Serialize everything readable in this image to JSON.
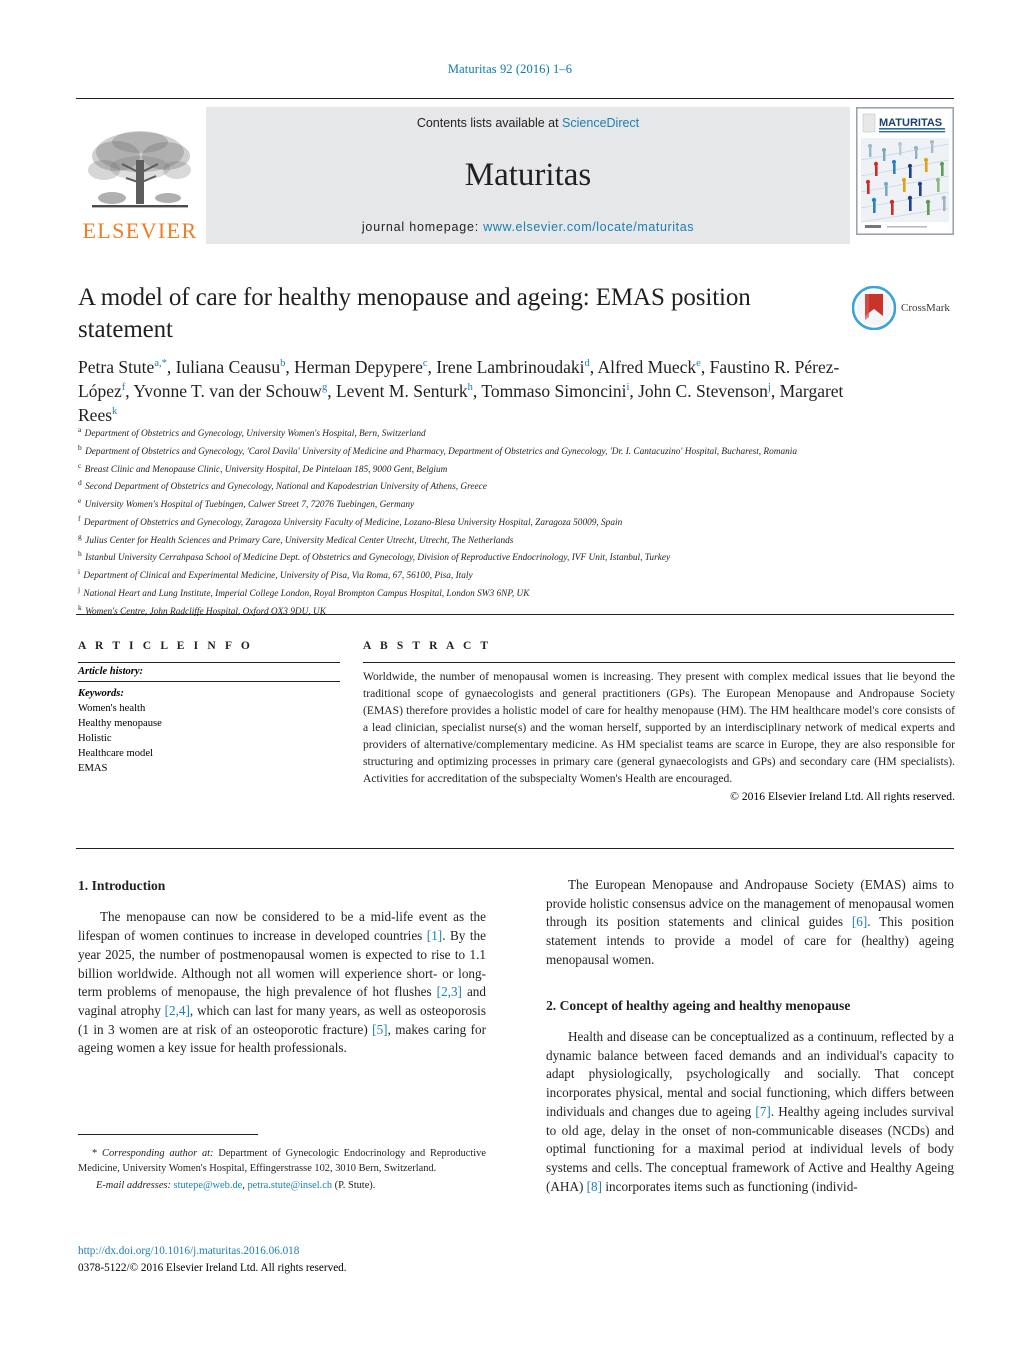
{
  "running_head": "Maturitas 92 (2016) 1–6",
  "masthead": {
    "publisher_name": "ELSEVIER",
    "contents_prefix": "Contents lists available at ",
    "contents_link": "ScienceDirect",
    "journal_name": "Maturitas",
    "homepage_label": "journal homepage:",
    "homepage_url": "www.elsevier.com/locate/maturitas",
    "cover_title": "MATURITAS",
    "link_color": "#1a7fb5",
    "band_color": "#e6e7e8",
    "elsevier_orange": "#ef7d23"
  },
  "article": {
    "title": "A model of care for healthy menopause and ageing: EMAS position statement",
    "crossmark_label": "CrossMark",
    "authors_html": "Petra Stute<sup>a</sup><sup>,*</sup>, Iuliana Ceausu<sup>b</sup>, Herman Depypere<sup>c</sup>, Irene Lambrinoudaki<sup>d</sup>, Alfred Mueck<sup>e</sup>, Faustino R. Pérez-López<sup>f</sup>, Yvonne T. van der Schouw<sup>g</sup>, Levent M. Senturk<sup>h</sup>, Tommaso Simoncini<sup>i</sup>, John C. Stevenson<sup>j</sup>, Margaret Rees<sup>k</sup>",
    "affiliations": [
      {
        "marker": "a",
        "text": "Department of Obstetrics and Gynecology, University Women's Hospital, Bern, Switzerland"
      },
      {
        "marker": "b",
        "text": "Department of Obstetrics and Gynecology, 'Carol Davila' University of Medicine and Pharmacy, Department of Obstetrics and Gynecology, 'Dr. I. Cantacuzino' Hospital, Bucharest, Romania"
      },
      {
        "marker": "c",
        "text": "Breast Clinic and Menopause Clinic, University Hospital, De Pintelaan 185, 9000 Gent, Belgium"
      },
      {
        "marker": "d",
        "text": "Second Department of Obstetrics and Gynecology, National and Kapodestrian University of Athens, Greece"
      },
      {
        "marker": "e",
        "text": "University Women's Hospital of Tuebingen, Calwer Street 7, 72076 Tuebingen, Germany"
      },
      {
        "marker": "f",
        "text": "Department of Obstetrics and Gynecology, Zaragoza University Faculty of Medicine, Lozano-Blesa University Hospital, Zaragoza 50009, Spain"
      },
      {
        "marker": "g",
        "text": "Julius Center for Health Sciences and Primary Care, University Medical Center Utrecht, Utrecht, The Netherlands"
      },
      {
        "marker": "h",
        "text": "Istanbul University Cerrahpasa School of Medicine Dept. of Obstetrics and Gynecology, Division of Reproductive Endocrinology, IVF Unit, Istanbul, Turkey"
      },
      {
        "marker": "i",
        "text": "Department of Clinical and Experimental Medicine, University of Pisa, Via Roma, 67, 56100, Pisa, Italy"
      },
      {
        "marker": "j",
        "text": "National Heart and Lung Institute, Imperial College London, Royal Brompton Campus Hospital, London SW3 6NP, UK"
      },
      {
        "marker": "k",
        "text": "Women's Centre, John Radcliffe Hospital, Oxford OX3 9DU, UK"
      }
    ]
  },
  "article_info": {
    "heading": "A R T I C L E   I N F O",
    "history_label": "Article history:",
    "keywords_label": "Keywords:",
    "keywords": [
      "Women's health",
      "Healthy menopause",
      "Holistic",
      "Healthcare model",
      "EMAS"
    ]
  },
  "abstract": {
    "heading": "A B S T R A C T",
    "text": "Worldwide, the number of menopausal women is increasing. They present with complex medical issues that lie beyond the traditional scope of gynaecologists and general practitioners (GPs). The European Menopause and Andropause Society (EMAS) therefore provides a holistic model of care for healthy menopause (HM). The HM healthcare model's core consists of a lead clinician, specialist nurse(s) and the woman herself, supported by an interdisciplinary network of medical experts and providers of alternative/complementary medicine. As HM specialist teams are scarce in Europe, they are also responsible for structuring and optimizing processes in primary care (general gynaecologists and GPs) and secondary care (HM specialists). Activities for accreditation of the subspecialty Women's Health are encouraged.",
    "copyright": "© 2016 Elsevier Ireland Ltd. All rights reserved."
  },
  "body": {
    "left": {
      "section1_heading": "1.  Introduction",
      "para1_html": "The menopause can now be considered to be a mid-life event as the lifespan of women continues to increase in developed countries <span class=\"ref\">[1]</span>. By the year 2025, the number of postmenopausal women is expected to rise to 1.1 billion worldwide. Although not all women will experience short- or long-term problems of menopause, the high prevalence of hot flushes <span class=\"ref\">[2,3]</span> and vaginal atrophy <span class=\"ref\">[2,4]</span>, which can last for many years, as well as osteoporosis (1 in 3 women are at risk of an osteoporotic fracture) <span class=\"ref\">[5]</span>, makes caring for ageing women a key issue for health professionals."
    },
    "right": {
      "para1_html": "The European Menopause and Andropause Society (EMAS) aims to provide holistic consensus advice on the management of menopausal women through its position statements and clinical guides <span class=\"ref\">[6]</span>. This position statement intends to provide a model of care for (healthy) ageing menopausal women.",
      "section2_heading": "2.  Concept of healthy ageing and healthy menopause",
      "para2_html": "Health and disease can be conceptualized as a continuum, reflected by a dynamic balance between faced demands and an individual's capacity to adapt physiologically, psychologically and socially. That concept incorporates physical, mental and social functioning, which differs between individuals and changes due to ageing <span class=\"ref\">[7]</span>. Healthy ageing includes survival to old age, delay in the onset of non-communicable diseases (NCDs) and optimal functioning for a maximal period at individual levels of body systems and cells. The conceptual framework of Active and Healthy Ageing (AHA) <span class=\"ref\">[8]</span> incorporates items such as functioning (individ-"
    }
  },
  "footnotes": {
    "corresponding_html": "* <span class=\"em\">Corresponding author at:</span> Department of Gynecologic Endocrinology and Reproductive Medicine, University Women's Hospital, Effingerstrasse 102, 3010 Bern, Switzerland.",
    "email_html": "<span class=\"em\">E-mail addresses:</span> <a class=\"mail\" href=\"#\">stutepe@web.de</a>, <a class=\"mail\" href=\"#\">petra.stute@insel.ch</a> (P. Stute).",
    "doi": "http://dx.doi.org/10.1016/j.maturitas.2016.06.018",
    "issn_line": "0378-5122/© 2016 Elsevier Ireland Ltd. All rights reserved."
  }
}
